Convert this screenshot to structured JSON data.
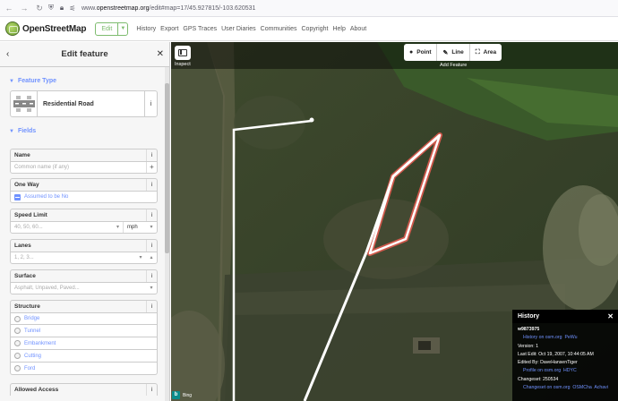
{
  "browser": {
    "url_prefix": "www.",
    "url_host": "openstreetmap.org",
    "url_path": "/edit#map=17/45.927815/-103.620531"
  },
  "header": {
    "brand": "OpenStreetMap",
    "edit_label": "Edit",
    "nav": [
      "History",
      "Export",
      "GPS Traces",
      "User Diaries",
      "Communities",
      "Copyright",
      "Help",
      "About"
    ]
  },
  "sidebar": {
    "title": "Edit feature",
    "feature_type_label": "Feature Type",
    "preset_name": "Residential Road",
    "fields_label": "Fields",
    "fields": {
      "name_label": "Name",
      "name_placeholder": "Common name (if any)",
      "oneway_label": "One Way",
      "oneway_value": "Assumed to be No",
      "speed_label": "Speed Limit",
      "speed_placeholder": "40, 50, 60...",
      "speed_unit": "mph",
      "lanes_label": "Lanes",
      "lanes_placeholder": "1, 2, 3...",
      "surface_label": "Surface",
      "surface_placeholder": "Asphalt, Unpaved, Paved...",
      "structure_label": "Structure",
      "structure_options": [
        "Bridge",
        "Tunnel",
        "Embankment",
        "Cutting",
        "Ford"
      ],
      "access_label": "Allowed Access"
    }
  },
  "map": {
    "inspect_label": "Inspect",
    "modes": [
      "Point",
      "Line",
      "Area"
    ],
    "add_feature_label": "Add Feature",
    "bing_label": "Bing"
  },
  "history": {
    "title": "History",
    "way_id": "w9873975",
    "history_link": "History on osm.org",
    "history_link2": "PeWu",
    "version": "Version:  1",
    "last_edit": "Last Edit:  Oct 19, 2007, 10:44:05 AM",
    "edited_by": "Edited By:  DaveHansenTiger",
    "profile_link": "Profile on osm.org",
    "profile_link2": "HDYC",
    "changeset": "Changeset:  250534",
    "changeset_link": "Changeset on osm.org",
    "changeset_link2": "OSMCha",
    "changeset_link3": "Achavi"
  }
}
